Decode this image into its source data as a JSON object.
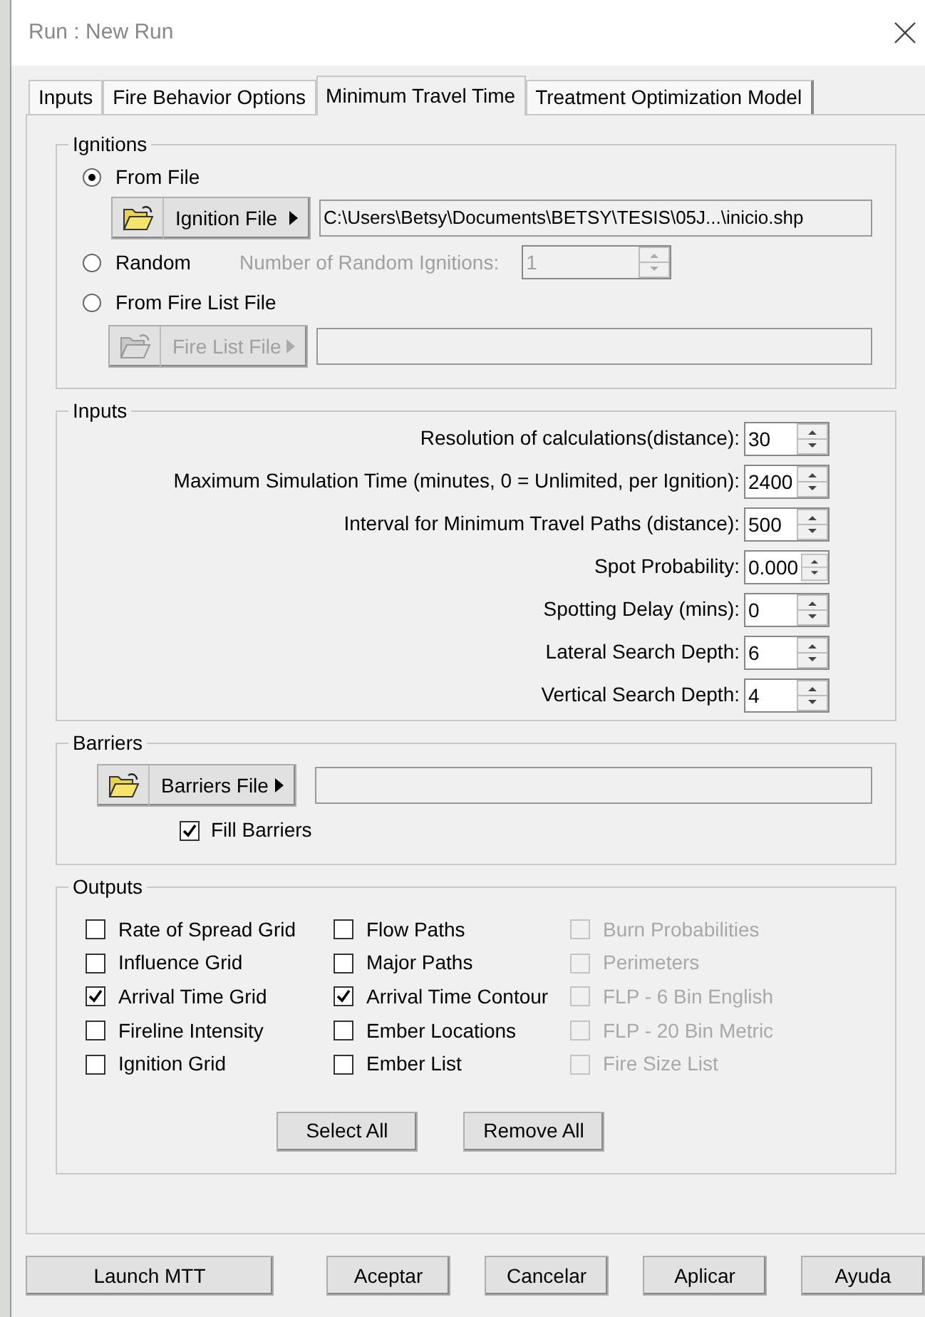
{
  "window": {
    "title": "Run : New Run"
  },
  "tabs": [
    {
      "label": "Inputs",
      "selected": false
    },
    {
      "label": "Fire Behavior Options",
      "selected": false
    },
    {
      "label": "Minimum Travel Time",
      "selected": true
    },
    {
      "label": "Treatment Optimization Model",
      "selected": false
    }
  ],
  "ignitions": {
    "title": "Ignitions",
    "options": [
      {
        "label": "From File",
        "selected": true
      },
      {
        "label": "Random",
        "selected": false
      },
      {
        "label": "From Fire List File",
        "selected": false
      }
    ],
    "ignition_file": {
      "button": "Ignition File",
      "path": "C:\\Users\\Betsy\\Documents\\BETSY\\TESIS\\05J...\\inicio.shp",
      "disabled": false
    },
    "random_count": {
      "label": "Number of Random Ignitions:",
      "value": "1",
      "disabled": true
    },
    "fire_list_file": {
      "button": "Fire List File",
      "disabled": true
    }
  },
  "inputs": {
    "title": "Inputs",
    "fields": [
      {
        "label": "Resolution of calculations(distance):",
        "value": "30"
      },
      {
        "label": "Maximum Simulation Time (minutes, 0 = Unlimited, per Ignition):",
        "value": "2400"
      },
      {
        "label": "Interval for Minimum Travel Paths (distance):",
        "value": "500"
      },
      {
        "label": "Spot Probability:",
        "value": "0.000"
      },
      {
        "label": "Spotting Delay (mins):",
        "value": "0"
      },
      {
        "label": "Lateral Search Depth:",
        "value": "6"
      },
      {
        "label": "Vertical Search Depth:",
        "value": "4"
      }
    ]
  },
  "barriers": {
    "title": "Barriers",
    "button": "Barriers File",
    "fill_barriers": {
      "label": "Fill Barriers",
      "checked": true
    }
  },
  "outputs": {
    "title": "Outputs",
    "columns": [
      [
        {
          "label": "Rate of Spread Grid",
          "checked": false,
          "disabled": false
        },
        {
          "label": "Influence Grid",
          "checked": false,
          "disabled": false
        },
        {
          "label": "Arrival Time Grid",
          "checked": true,
          "disabled": false
        },
        {
          "label": "Fireline Intensity",
          "checked": false,
          "disabled": false
        },
        {
          "label": "Ignition Grid",
          "checked": false,
          "disabled": false
        }
      ],
      [
        {
          "label": "Flow Paths",
          "checked": false,
          "disabled": false
        },
        {
          "label": "Major Paths",
          "checked": false,
          "disabled": false
        },
        {
          "label": "Arrival Time Contour",
          "checked": true,
          "disabled": false
        },
        {
          "label": "Ember Locations",
          "checked": false,
          "disabled": false
        },
        {
          "label": "Ember List",
          "checked": false,
          "disabled": false
        }
      ],
      [
        {
          "label": "Burn Probabilities",
          "checked": false,
          "disabled": true
        },
        {
          "label": "Perimeters",
          "checked": false,
          "disabled": true
        },
        {
          "label": "FLP - 6 Bin English",
          "checked": false,
          "disabled": true
        },
        {
          "label": "FLP - 20 Bin Metric",
          "checked": false,
          "disabled": true
        },
        {
          "label": "Fire Size List",
          "checked": false,
          "disabled": true
        }
      ]
    ],
    "buttons": [
      "Select All",
      "Remove All"
    ]
  },
  "footer_buttons": [
    "Launch MTT",
    "Aceptar",
    "Cancelar",
    "Aplicar",
    "Ayuda"
  ]
}
